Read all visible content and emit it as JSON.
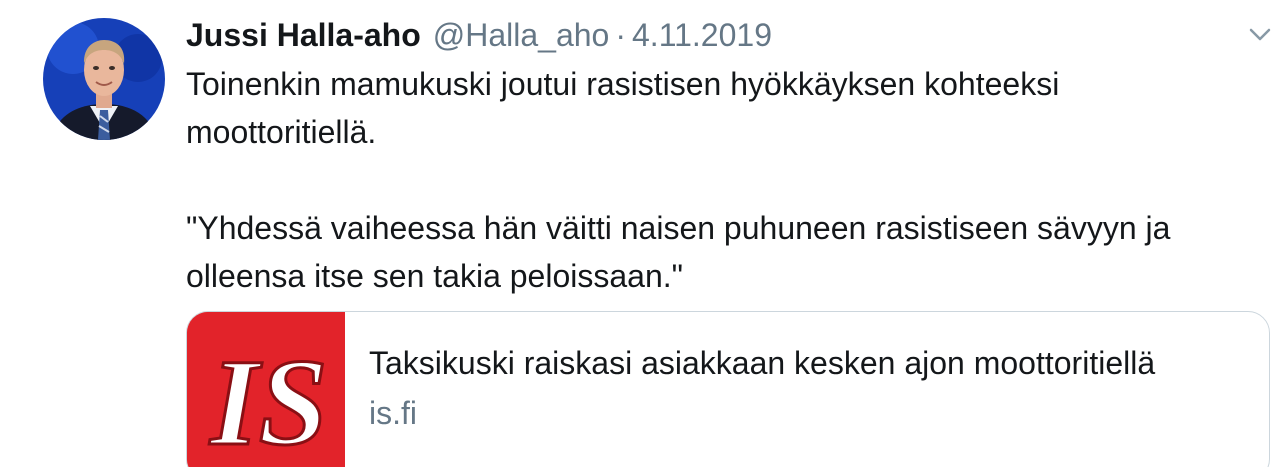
{
  "tweet": {
    "author_name": "Jussi Halla-aho",
    "handle": "@Halla_aho",
    "separator": "·",
    "date": "4.11.2019",
    "paragraph_1": "Toinenkin mamukuski joutui rasistisen hyökkäyksen kohteeksi moottoritiellä.",
    "paragraph_2": "\"Yhdessä vaiheessa hän väitti naisen puhuneen rasistiseen sävyyn ja olleensa itse sen takia peloissaan.\""
  },
  "card": {
    "logo_text": "IS",
    "title": "Taksikuski raiskasi asiakkaan kesken ajon moottoritiellä",
    "domain": "is.fi"
  },
  "icons": {
    "menu": "chevron-down-icon",
    "avatar": "profile-photo"
  },
  "colors": {
    "text": "#14171a",
    "secondary": "#657786",
    "border": "#ccd6dd",
    "logo_red": "#e2232a",
    "avatar_bg": "#1640b8"
  }
}
